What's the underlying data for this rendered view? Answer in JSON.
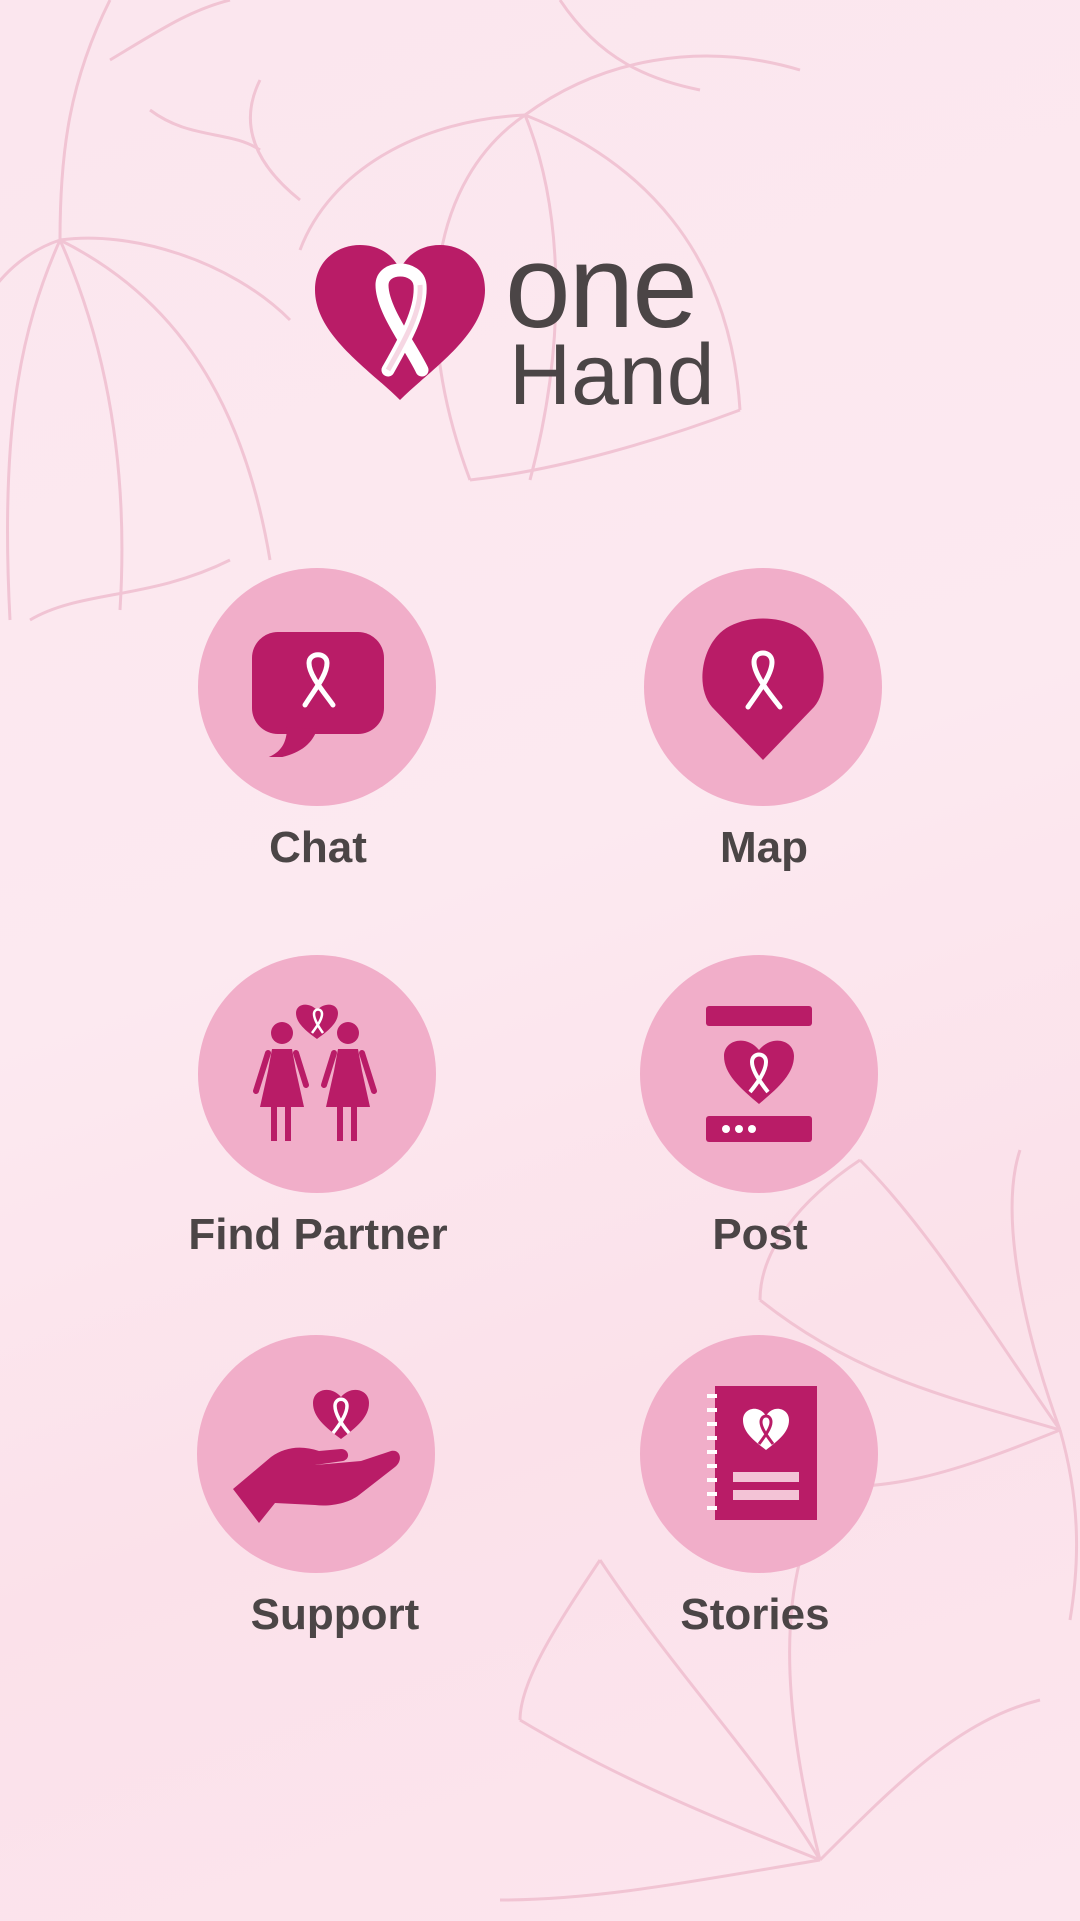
{
  "app": {
    "logo_text_top": "one",
    "logo_text_bottom": "Hand"
  },
  "colors": {
    "brand": "#b91c67",
    "circle": "#f1aec9",
    "text": "#4b4546",
    "background": "#fbe6ee"
  },
  "menu": {
    "chat": {
      "label": "Chat",
      "icon": "chat-bubble-ribbon-icon"
    },
    "map": {
      "label": "Map",
      "icon": "map-pin-ribbon-icon"
    },
    "find_partner": {
      "label": "Find Partner",
      "icon": "two-women-heart-icon"
    },
    "post": {
      "label": "Post",
      "icon": "post-card-heart-icon"
    },
    "support": {
      "label": "Support",
      "icon": "hand-heart-icon"
    },
    "stories": {
      "label": "Stories",
      "icon": "notebook-heart-icon"
    }
  }
}
